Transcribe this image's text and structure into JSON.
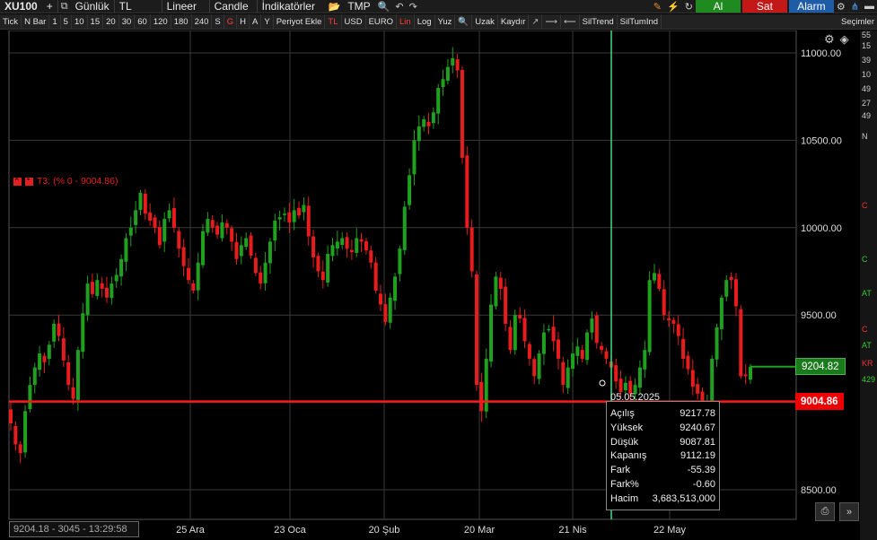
{
  "toolbar1": {
    "symbol": "XU100",
    "plus": "+",
    "period": "Günlük",
    "currency": "TL",
    "scale": "Lineer",
    "chart_type": "Candle",
    "indicators": "İndikatörler",
    "tmp": "TMP",
    "buy": "Al",
    "sell": "Sat",
    "alarm": "Alarm"
  },
  "toolbar2": {
    "items": [
      "Tick",
      "N Bar",
      "1",
      "5",
      "10",
      "15",
      "20",
      "30",
      "60",
      "120",
      "180",
      "240",
      "S",
      "G",
      "H",
      "A",
      "Y",
      "Periyot Ekle",
      "TL",
      "USD",
      "EURO",
      "Lin",
      "Log",
      "Yuz",
      "Uzak",
      "Kaydır",
      "SilTrend",
      "SilTumInd",
      "Seçimler"
    ],
    "active": [
      "G",
      "TL",
      "Lin"
    ]
  },
  "right_strip": [
    "55",
    "10",
    "15",
    "39",
    "10",
    "49",
    "27",
    "49",
    "N",
    "C",
    "C",
    "AT",
    "C",
    "AT",
    "KR",
    "429"
  ],
  "t3_label": "T3: (% 0 - 9004.86)",
  "price_green": "9204.82",
  "price_red": "9004.86",
  "status_bar": "9204.18 - 3045 - 13:29:58",
  "tooltip": {
    "date": "05.05.2025",
    "rows": [
      {
        "k": "Açılış",
        "v": "9217.78"
      },
      {
        "k": "Yüksek",
        "v": "9240.67"
      },
      {
        "k": "Düşük",
        "v": "9087.81"
      },
      {
        "k": "Kapanış",
        "v": "9112.19"
      },
      {
        "k": "Fark",
        "v": "-55.39"
      },
      {
        "k": "Fark%",
        "v": "-0.60"
      },
      {
        "k": "Hacim",
        "v": "3,683,513,000"
      }
    ]
  },
  "colors": {
    "up": "#1fa11f",
    "down": "#e81c1c",
    "grid": "#3a3a3a",
    "crosshair": "#3ddc84",
    "level": "#ff1a1a"
  },
  "chart_data": {
    "type": "candlestick",
    "ylim": [
      8400,
      11100
    ],
    "y_ticks": [
      8500,
      9500,
      10000,
      10500,
      11000
    ],
    "y_tick_labels": [
      "8500.00",
      "9500.00",
      "10000.00",
      "10500.00",
      "11000.00"
    ],
    "x_ticks": [
      "25 Ara",
      "23 Oca",
      "20 Şub",
      "20 Mar",
      "21 Nis",
      "22 May"
    ],
    "level": 9004.86,
    "last": 9204.82,
    "closes": [
      8880,
      8760,
      8710,
      8950,
      9100,
      9200,
      9280,
      9230,
      9330,
      9450,
      9380,
      9240,
      9100,
      9020,
      9300,
      9510,
      9680,
      9620,
      9700,
      9650,
      9600,
      9680,
      9730,
      9820,
      9940,
      10000,
      10100,
      10200,
      10080,
      10040,
      10000,
      9900,
      10050,
      10100,
      10000,
      9880,
      9780,
      9700,
      9640,
      9800,
      9980,
      10050,
      10000,
      9960,
      10030,
      10000,
      9920,
      9820,
      9900,
      9940,
      9840,
      9740,
      9680,
      9800,
      9920,
      10040,
      10060,
      10080,
      10030,
      10100,
      10070,
      10130,
      9950,
      9830,
      9750,
      9700,
      9850,
      9900,
      9920,
      9940,
      9880,
      9860,
      9940,
      9920,
      9870,
      9800,
      9640,
      9560,
      9460,
      9600,
      9720,
      9880,
      10120,
      10300,
      10500,
      10580,
      10620,
      10580,
      10660,
      10800,
      10850,
      10920,
      10970,
      10900,
      10400,
      10000,
      9750,
      9100,
      8950,
      9250,
      9560,
      9720,
      9650,
      9450,
      9300,
      9500,
      9480,
      9350,
      9250,
      9150,
      9280,
      9400,
      9420,
      9350,
      9250,
      9100,
      9200,
      9280,
      9320,
      9250,
      9400,
      9480,
      9340,
      9300,
      9250,
      9200,
      9120,
      9060,
      9112,
      9050,
      9100,
      9200,
      9300,
      9700,
      9740,
      9650,
      9500,
      9470,
      9450,
      9380,
      9250,
      9190,
      9090,
      9050,
      8990,
      9000,
      9250,
      9430,
      9600,
      9700,
      9700,
      9550,
      9150,
      9150,
      9204
    ]
  }
}
